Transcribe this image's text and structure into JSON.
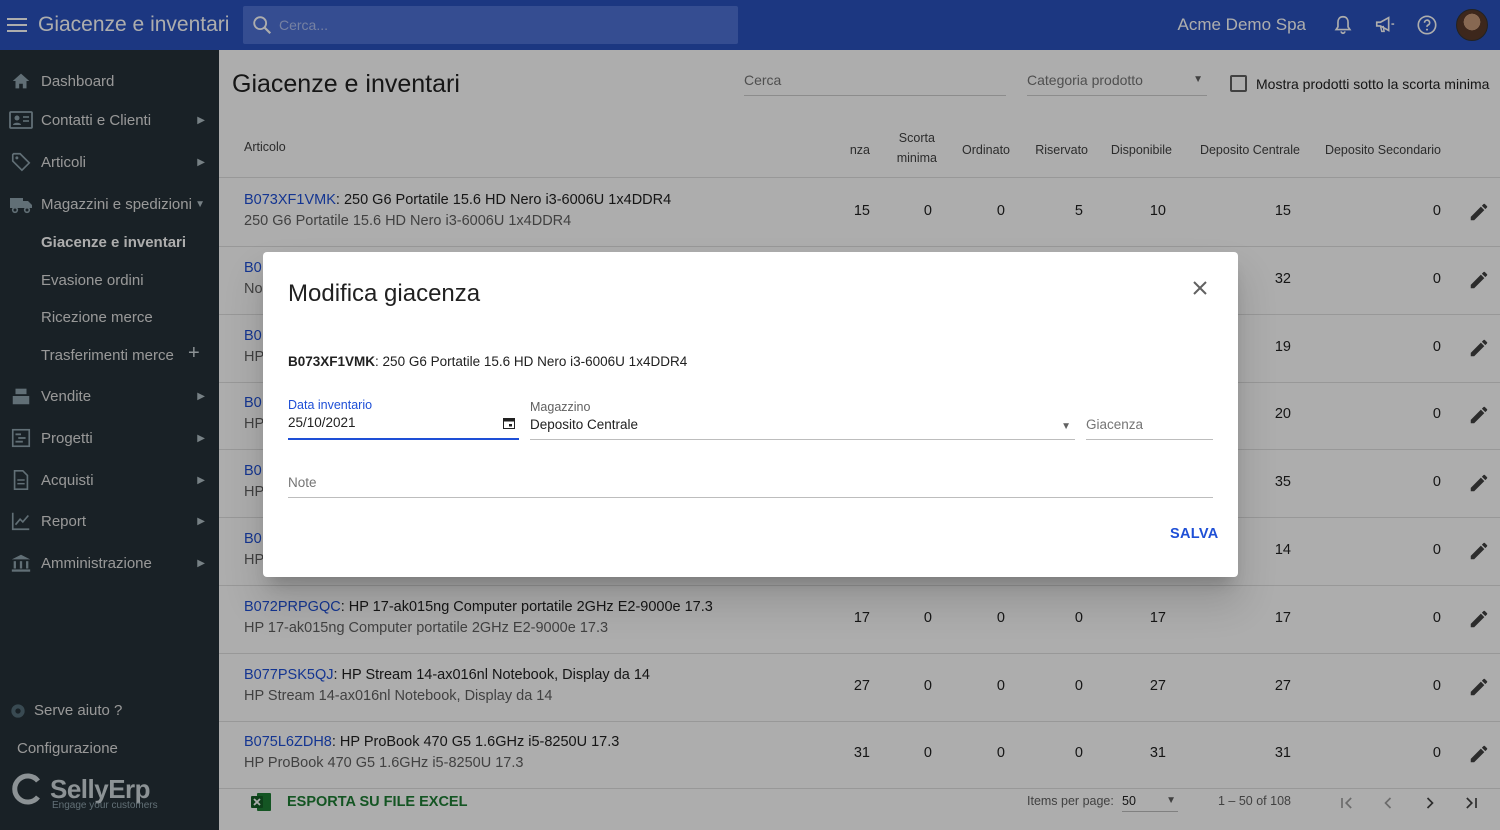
{
  "app": {
    "title": "Giacenze e inventari",
    "company": "Acme Demo Spa",
    "search_placeholder": "Cerca..."
  },
  "sidebar": {
    "items": [
      {
        "label": "Dashboard",
        "icon": "home-icon"
      },
      {
        "label": "Contatti e Clienti",
        "icon": "contacts-icon"
      },
      {
        "label": "Articoli",
        "icon": "tag-icon"
      },
      {
        "label": "Magazzini e spedizioni",
        "icon": "truck-icon"
      },
      {
        "label": "Vendite",
        "icon": "register-icon"
      },
      {
        "label": "Progetti",
        "icon": "gantt-icon"
      },
      {
        "label": "Acquisti",
        "icon": "document-icon"
      },
      {
        "label": "Report",
        "icon": "chart-icon"
      },
      {
        "label": "Amministrazione",
        "icon": "bank-icon"
      }
    ],
    "subitems": [
      "Giacenze e inventari",
      "Evasione ordini",
      "Ricezione merce",
      "Trasferimenti merce"
    ],
    "help": "Serve aiuto ?",
    "config": "Configurazione",
    "brand": "SellyErp",
    "tagline": "Engage your customers"
  },
  "main": {
    "title": "Giacenze e inventari",
    "filter_search": "Cerca",
    "filter_category": "Categoria prodotto",
    "checkbox_label": "Mostra prodotti sotto la scorta minima",
    "headers": {
      "articolo": "Articolo",
      "giacenza": "nza",
      "scorta1": "Scorta",
      "scorta2": "minima",
      "ordinato": "Ordinato",
      "riservato": "Riservato",
      "disponibile": "Disponibile",
      "centrale": "Deposito Centrale",
      "secondario": "Deposito Secondario"
    },
    "rows": [
      {
        "code": "B073XF1VMK",
        "name": ": 250 G6 Portatile 15.6 HD Nero i3-6006U 1x4DDR4",
        "desc": "250 G6 Portatile 15.6 HD Nero i3-6006U 1x4DDR4",
        "g": "15",
        "s": "0",
        "o": "0",
        "r": "5",
        "d": "10",
        "c": "15",
        "sec": "0"
      },
      {
        "code": "B0",
        "name": "",
        "desc": "No",
        "g": "",
        "s": "",
        "o": "",
        "r": "",
        "d": "",
        "c": "32",
        "sec": "0"
      },
      {
        "code": "B0",
        "name": "",
        "desc": "HP",
        "g": "",
        "s": "",
        "o": "",
        "r": "",
        "d": "",
        "c": "19",
        "sec": "0"
      },
      {
        "code": "B0",
        "name": "",
        "desc": "HP",
        "g": "",
        "s": "",
        "o": "",
        "r": "",
        "d": "",
        "c": "20",
        "sec": "0"
      },
      {
        "code": "B0",
        "name": "",
        "desc": "HP",
        "g": "",
        "s": "",
        "o": "",
        "r": "",
        "d": "",
        "c": "35",
        "sec": "0"
      },
      {
        "code": "B0",
        "name": "",
        "desc": "HP",
        "g": "",
        "s": "",
        "o": "",
        "r": "",
        "d": "",
        "c": "14",
        "sec": "0"
      },
      {
        "code": "B072PRPGQC",
        "name": ": HP 17-ak015ng Computer portatile 2GHz E2-9000e 17.3",
        "desc": "HP 17-ak015ng Computer portatile 2GHz E2-9000e 17.3",
        "g": "17",
        "s": "0",
        "o": "0",
        "r": "0",
        "d": "17",
        "c": "17",
        "sec": "0"
      },
      {
        "code": "B077PSK5QJ",
        "name": ": HP Stream 14-ax016nl Notebook, Display da 14",
        "desc": "HP Stream 14-ax016nl Notebook, Display da 14",
        "g": "27",
        "s": "0",
        "o": "0",
        "r": "0",
        "d": "27",
        "c": "27",
        "sec": "0"
      },
      {
        "code": "B075L6ZDH8",
        "name": ": HP ProBook 470 G5 1.6GHz i5-8250U 17.3",
        "desc": "HP ProBook 470 G5 1.6GHz i5-8250U 17.3",
        "g": "31",
        "s": "0",
        "o": "0",
        "r": "0",
        "d": "31",
        "c": "31",
        "sec": "0"
      }
    ],
    "export_label": "ESPORTA SU FILE EXCEL",
    "items_per_page_label": "Items per page:",
    "items_per_page": "50",
    "range": "1 – 50 of 108"
  },
  "dialog": {
    "title": "Modifica giacenza",
    "product_code": "B073XF1VMK",
    "product_name": ": 250 G6 Portatile 15.6 HD Nero i3-6006U 1x4DDR4",
    "date_label": "Data inventario",
    "date_value": "25/10/2021",
    "warehouse_label": "Magazzino",
    "warehouse_value": "Deposito Centrale",
    "stock_placeholder": "Giacenza",
    "note_placeholder": "Note",
    "save_label": "SALVA"
  },
  "colors": {
    "primary": "#2a52be",
    "sidebar": "#263238",
    "link": "#1e4fd6",
    "excel": "#1e7e34"
  }
}
